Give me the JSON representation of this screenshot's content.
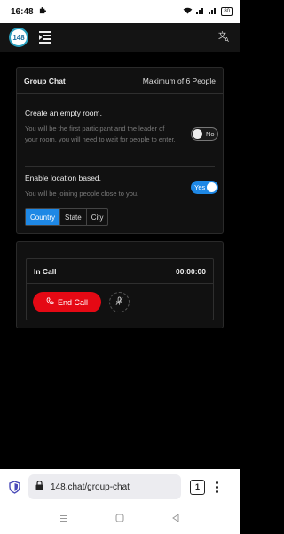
{
  "status_bar": {
    "time": "16:48",
    "battery": "80"
  },
  "app": {
    "logo_text": "148"
  },
  "group_chat": {
    "title": "Group Chat",
    "max_label": "Maximum of 6 People",
    "empty_room": {
      "title": "Create an empty room.",
      "description": "You will be the first participant and the leader of your room, you will need to wait for people to enter.",
      "toggle_label": "No"
    },
    "location": {
      "title": "Enable location based.",
      "description": "You will be joining people close to you.",
      "toggle_label": "Yes",
      "options": [
        "Country",
        "State",
        "City"
      ]
    }
  },
  "call": {
    "status": "In Call",
    "timer": "00:00:00",
    "end_label": "End Call"
  },
  "browser": {
    "url": "148.chat/group-chat",
    "tab_count": "1"
  }
}
